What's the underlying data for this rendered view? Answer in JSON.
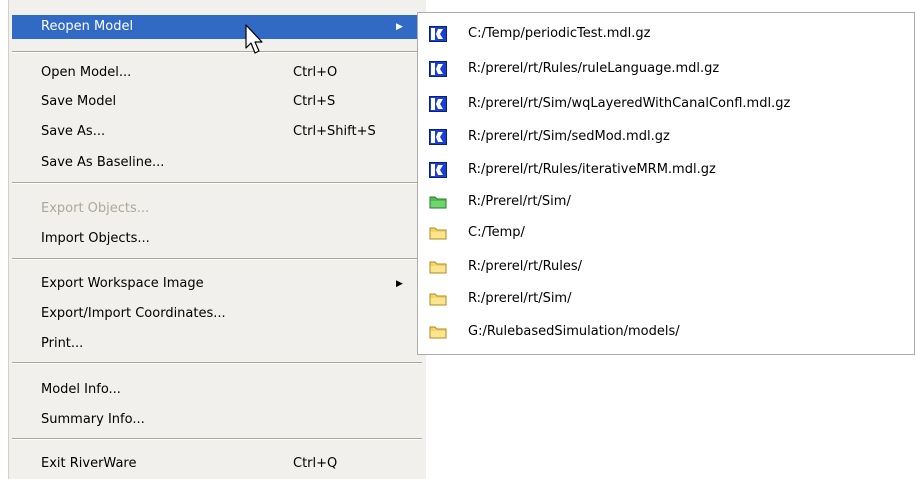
{
  "menu": {
    "items": [
      {
        "label": "Reopen Model",
        "shortcut": "",
        "submenu": true,
        "highlighted": true,
        "disabled": false
      },
      {
        "label": "Open Model...",
        "shortcut": "Ctrl+O"
      },
      {
        "label": "Save Model",
        "shortcut": "Ctrl+S"
      },
      {
        "label": "Save As...",
        "shortcut": "Ctrl+Shift+S"
      },
      {
        "label": "Save As Baseline...",
        "shortcut": ""
      },
      {
        "label": "Export Objects...",
        "shortcut": "",
        "disabled": true
      },
      {
        "label": "Import Objects...",
        "shortcut": ""
      },
      {
        "label": "Export Workspace Image",
        "shortcut": "",
        "submenu": true
      },
      {
        "label": "Export/Import Coordinates...",
        "shortcut": ""
      },
      {
        "label": "Print...",
        "shortcut": ""
      },
      {
        "label": "Model Info...",
        "shortcut": ""
      },
      {
        "label": "Summary Info...",
        "shortcut": ""
      },
      {
        "label": "Exit RiverWare",
        "shortcut": "Ctrl+Q"
      }
    ],
    "submenu_arrow": "▶"
  },
  "submenu": {
    "items": [
      {
        "label": "C:/Temp/periodicTest.mdl.gz",
        "icon": "model-file-icon"
      },
      {
        "label": "R:/prerel/rt/Rules/ruleLanguage.mdl.gz",
        "icon": "model-file-icon"
      },
      {
        "label": "R:/prerel/rt/Sim/wqLayeredWithCanalConfl.mdl.gz",
        "icon": "model-file-icon"
      },
      {
        "label": "R:/prerel/rt/Sim/sedMod.mdl.gz",
        "icon": "model-file-icon"
      },
      {
        "label": "R:/prerel/rt/Rules/iterativeMRM.mdl.gz",
        "icon": "model-file-icon"
      },
      {
        "label": "R:/Prerel/rt/Sim/",
        "icon": "green-folder-icon"
      },
      {
        "label": "C:/Temp/",
        "icon": "folder-icon"
      },
      {
        "label": "R:/prerel/rt/Rules/",
        "icon": "folder-icon"
      },
      {
        "label": "R:/prerel/rt/Sim/",
        "icon": "folder-icon"
      },
      {
        "label": "G:/RulebasedSimulation/models/",
        "icon": "folder-icon"
      }
    ]
  },
  "colors": {
    "highlight": "#316ac5",
    "menu_bg": "#f1f0ec",
    "disabled_text": "#aca899",
    "folder_yellow": "#f5d468",
    "folder_green": "#4cc04c",
    "model_icon_blue": "#1a3fd6"
  }
}
